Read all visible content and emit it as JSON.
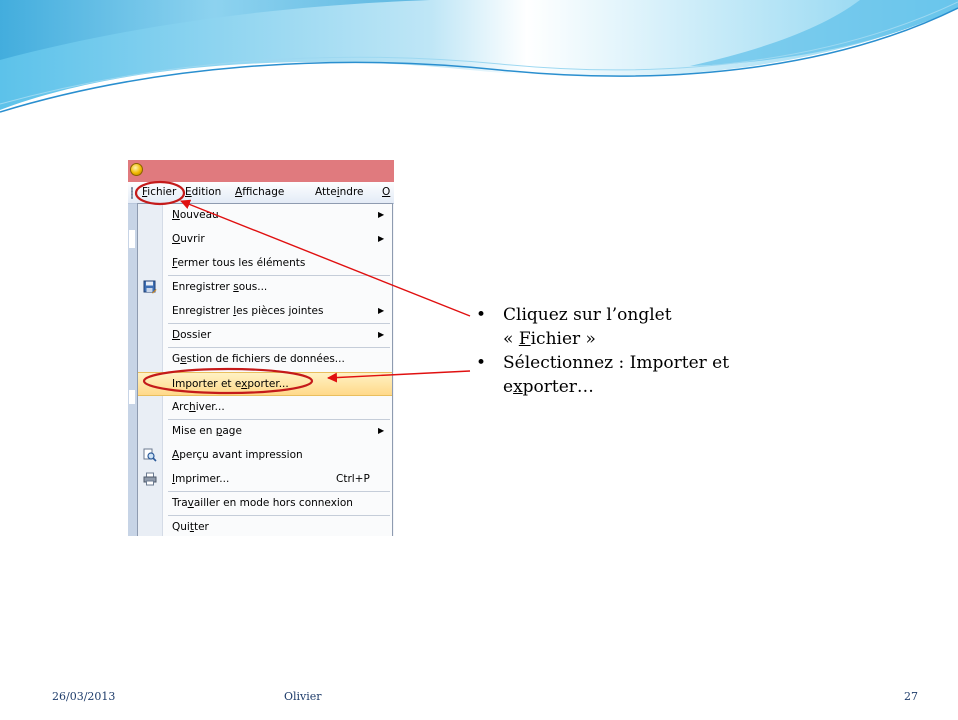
{
  "menubar": {
    "items": [
      {
        "before": "",
        "accent": "F",
        "after": "ichier"
      },
      {
        "before": "",
        "accent": "E",
        "after": "dition"
      },
      {
        "before": "",
        "accent": "A",
        "after": "ffichage"
      },
      {
        "before": "Atte",
        "accent": "i",
        "after": "ndre"
      },
      {
        "before": "",
        "accent": "O",
        "after": ""
      }
    ]
  },
  "file_menu": {
    "items": [
      {
        "before": "",
        "accent": "N",
        "after": "ouveau",
        "submenu": true
      },
      {
        "before": "",
        "accent": "O",
        "after": "uvrir",
        "submenu": true
      },
      {
        "before": "",
        "accent": "F",
        "after": "ermer tous les éléments"
      },
      {
        "before": "Enregistrer ",
        "accent": "s",
        "after": "ous...",
        "icon": "save-as-icon"
      },
      {
        "before": "Enregistrer ",
        "accent": "l",
        "after": "es pièces jointes",
        "submenu": true
      },
      {
        "before": "",
        "accent": "D",
        "after": "ossier",
        "submenu": true
      },
      {
        "before": "G",
        "accent": "e",
        "after": "stion de fichiers de données..."
      },
      {
        "before": "Importer et e",
        "accent": "x",
        "after": "porter...",
        "highlighted": true
      },
      {
        "before": "Arc",
        "accent": "h",
        "after": "iver..."
      },
      {
        "before": "Mise en ",
        "accent": "p",
        "after": "age",
        "submenu": true
      },
      {
        "before": "",
        "accent": "A",
        "after": "perçu avant impression",
        "icon": "print-preview-icon"
      },
      {
        "before": "",
        "accent": "I",
        "after": "mprimer...",
        "shortcut": "Ctrl+P",
        "icon": "printer-icon"
      },
      {
        "before": "Tra",
        "accent": "v",
        "after": "ailler en mode hors connexion"
      },
      {
        "before": "Qui",
        "accent": "t",
        "after": "ter"
      }
    ],
    "submenu_arrow": "▶"
  },
  "bullets": [
    {
      "marker": "•",
      "line1": "Cliquez sur l’onglet",
      "line2_before": "« ",
      "line2_accent": "F",
      "line2_after": "ichier »"
    },
    {
      "marker": "•",
      "line1": "Sélectionnez : Importer et",
      "line2_before": "e",
      "line2_accent": "x",
      "line2_after": "porter…"
    }
  ],
  "footer": {
    "date": "26/03/2013",
    "author": "Olivier",
    "page": "27"
  },
  "colors": {
    "callout": "#e01010",
    "header_blue": "#3aa6d9",
    "footer_text": "#1f3d6b"
  }
}
